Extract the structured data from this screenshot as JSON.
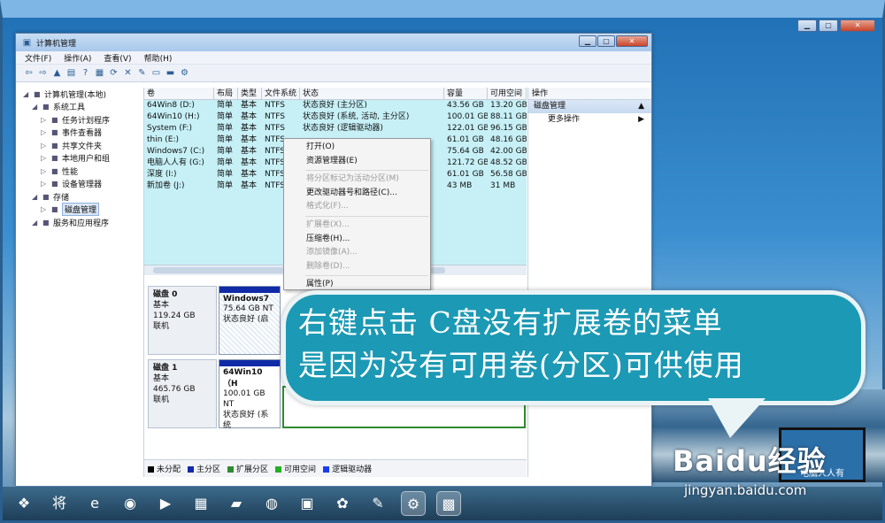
{
  "app": {
    "title": "计算机管理",
    "menu": [
      "文件(F)",
      "操作(A)",
      "查看(V)",
      "帮助(H)"
    ],
    "toolbar_icons": [
      "back-icon",
      "forward-icon",
      "up-icon",
      "show-hide-tree-icon",
      "help-icon",
      "properties-icon",
      "refresh-icon",
      "delete-icon",
      "new-icon",
      "open-icon",
      "save-icon",
      "settings-icon"
    ]
  },
  "tree": [
    {
      "label": "计算机管理(本地)",
      "level": 0,
      "icon": "computer-icon"
    },
    {
      "label": "系统工具",
      "level": 1,
      "icon": "tools-icon"
    },
    {
      "label": "任务计划程序",
      "level": 2,
      "icon": "clock-icon"
    },
    {
      "label": "事件查看器",
      "level": 2,
      "icon": "event-viewer-icon"
    },
    {
      "label": "共享文件夹",
      "level": 2,
      "icon": "shared-folder-icon"
    },
    {
      "label": "本地用户和组",
      "level": 2,
      "icon": "users-icon"
    },
    {
      "label": "性能",
      "level": 2,
      "icon": "performance-icon"
    },
    {
      "label": "设备管理器",
      "level": 2,
      "icon": "device-manager-icon"
    },
    {
      "label": "存储",
      "level": 1,
      "icon": "storage-icon"
    },
    {
      "label": "磁盘管理",
      "level": 2,
      "icon": "disk-management-icon",
      "selected": true
    },
    {
      "label": "服务和应用程序",
      "level": 1,
      "icon": "services-icon"
    }
  ],
  "volumes": {
    "headers": [
      "卷",
      "布局",
      "类型",
      "文件系统",
      "状态",
      "容量",
      "可用空间"
    ],
    "rows": [
      [
        "64Win8 (D:)",
        "简单",
        "基本",
        "NTFS",
        "状态良好 (主分区)",
        "43.56 GB",
        "13.20 GB"
      ],
      [
        "64Win10 (H:)",
        "简单",
        "基本",
        "NTFS",
        "状态良好 (系统, 活动, 主分区)",
        "100.01 GB",
        "88.11 GB"
      ],
      [
        "System (F:)",
        "简单",
        "基本",
        "NTFS",
        "状态良好 (逻辑驱动器)",
        "122.01 GB",
        "96.15 GB"
      ],
      [
        "thin (E:)",
        "简单",
        "基本",
        "NTFS",
        "",
        "61.01 GB",
        "48.16 GB"
      ],
      [
        "Windows7 (C:)",
        "简单",
        "基本",
        "NTFS",
        "",
        "75.64 GB",
        "42.00 GB"
      ],
      [
        "电脑人人有 (G:)",
        "简单",
        "基本",
        "NTFS",
        "",
        "121.72 GB",
        "48.52 GB"
      ],
      [
        "深度 (I:)",
        "简单",
        "基本",
        "NTFS",
        "",
        "61.01 GB",
        "56.58 GB"
      ],
      [
        "新加卷 (J:)",
        "简单",
        "基本",
        "NTFS",
        "",
        "43 MB",
        "31 MB"
      ]
    ]
  },
  "disks": [
    {
      "name": "磁盘 0",
      "type": "基本",
      "size": "119.24 GB",
      "status": "联机",
      "partition": {
        "name": "Windows7",
        "size": "75.64 GB NT",
        "status": "状态良好 (启"
      }
    },
    {
      "name": "磁盘 1",
      "type": "基本",
      "size": "465.76 GB",
      "status": "联机",
      "partition": {
        "name": "64Win10 （H",
        "size": "100.01 GB NT",
        "status": "状态良好 (系统"
      }
    }
  ],
  "legend": [
    {
      "label": "未分配",
      "color": "#000000"
    },
    {
      "label": "主分区",
      "color": "#102aa8"
    },
    {
      "label": "扩展分区",
      "color": "#2f8a2f"
    },
    {
      "label": "可用空间",
      "color": "#22b022"
    },
    {
      "label": "逻辑驱动器",
      "color": "#1a3cf0"
    }
  ],
  "actions": {
    "header": "操作",
    "group": "磁盘管理",
    "more": "更多操作"
  },
  "context_menu": {
    "items": [
      {
        "label": "打开(O)",
        "enabled": true
      },
      {
        "label": "资源管理器(E)",
        "enabled": true
      },
      {
        "sep": true
      },
      {
        "label": "将分区标记为活动分区(M)",
        "enabled": false
      },
      {
        "label": "更改驱动器号和路径(C)...",
        "enabled": true
      },
      {
        "label": "格式化(F)...",
        "enabled": false
      },
      {
        "sep": true
      },
      {
        "label": "扩展卷(X)...",
        "enabled": false
      },
      {
        "label": "压缩卷(H)...",
        "enabled": true
      },
      {
        "label": "添加镜像(A)...",
        "enabled": false
      },
      {
        "label": "删除卷(D)...",
        "enabled": false
      },
      {
        "sep": true
      },
      {
        "label": "属性(P)",
        "enabled": true
      }
    ]
  },
  "bubble": {
    "line1": "右键点击 C盘没有扩展卷的菜单",
    "line2": "是因为没有可用卷(分区)可供使用"
  },
  "taskbar": [
    "start-icon",
    "jiang-app-icon",
    "ie-icon",
    "chrome-icon",
    "media-player-icon",
    "explorer-icon",
    "folder-icon",
    "app-icon",
    "network-icon",
    "pinwheel-icon",
    "paint-icon",
    "settings-app-icon",
    "computer-management-icon"
  ],
  "watermark": {
    "brand": "Baidu经验",
    "url": "jingyan.baidu.com",
    "laptop_text": "电脑人人有"
  }
}
